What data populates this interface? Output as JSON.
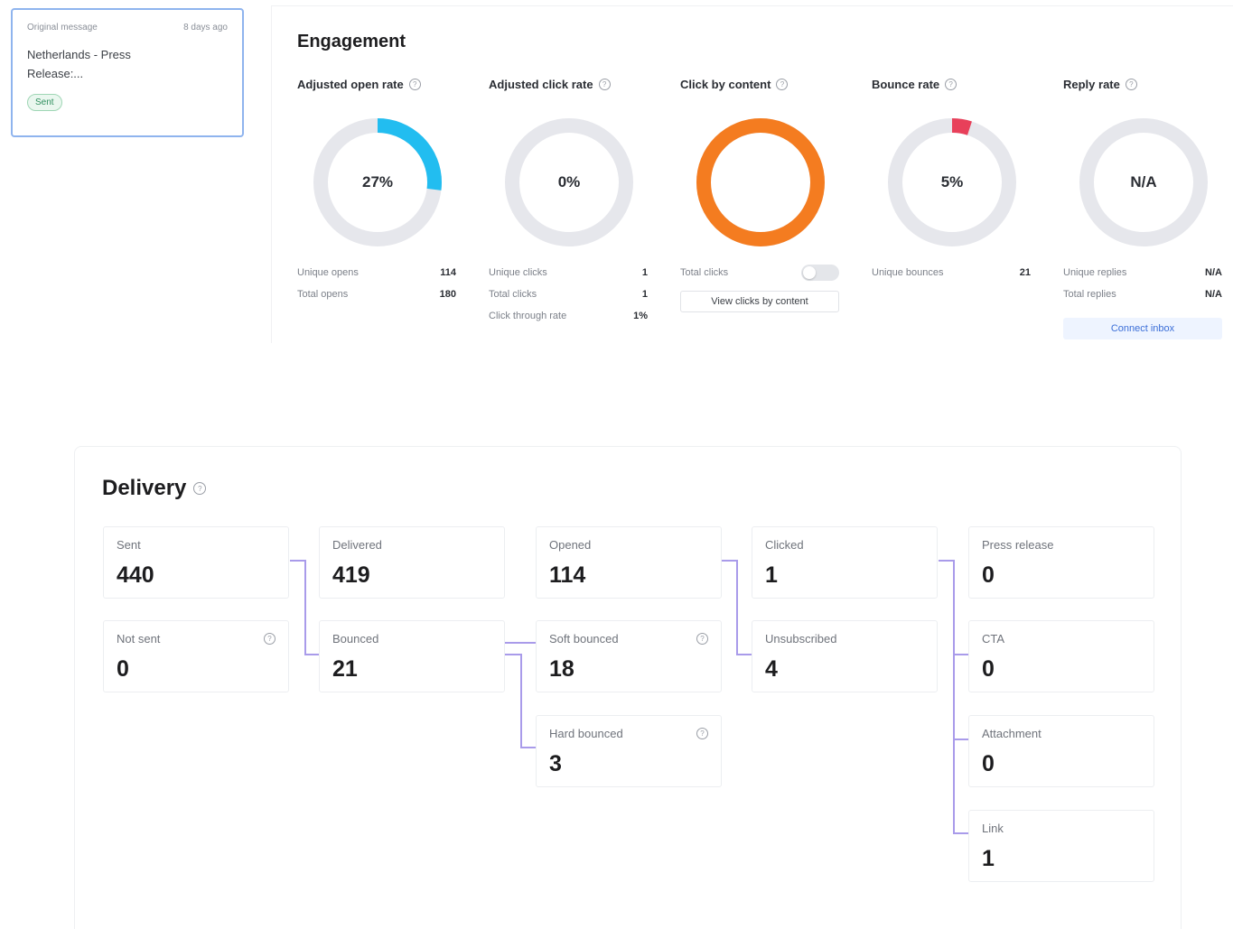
{
  "message_card": {
    "label": "Original message",
    "time": "8 days ago",
    "title": "Netherlands - Press Release:...",
    "status": "Sent"
  },
  "engagement": {
    "title": "Engagement",
    "columns": [
      {
        "title": "Adjusted open rate",
        "center": "27%",
        "percent": 27,
        "color": "#22bdf0",
        "stats": [
          {
            "label": "Unique opens",
            "value": "114"
          },
          {
            "label": "Total opens",
            "value": "180"
          }
        ]
      },
      {
        "title": "Adjusted click rate",
        "center": "0%",
        "percent": 0,
        "color": "#22bdf0",
        "stats": [
          {
            "label": "Unique clicks",
            "value": "1"
          },
          {
            "label": "Total clicks",
            "value": "1"
          },
          {
            "label": "Click through rate",
            "value": "1%"
          }
        ]
      },
      {
        "title": "Click by content",
        "center": "",
        "percent": 100,
        "color": "#f47c20",
        "toggle_label": "Total clicks",
        "button_label": "View clicks by content"
      },
      {
        "title": "Bounce rate",
        "center": "5%",
        "percent": 5,
        "color": "#e8405a",
        "stats": [
          {
            "label": "Unique bounces",
            "value": "21"
          }
        ]
      },
      {
        "title": "Reply rate",
        "center": "N/A",
        "percent": 0,
        "color": "#22bdf0",
        "stats": [
          {
            "label": "Unique replies",
            "value": "N/A"
          },
          {
            "label": "Total replies",
            "value": "N/A"
          }
        ],
        "link_label": "Connect inbox"
      }
    ]
  },
  "delivery": {
    "title": "Delivery",
    "boxes": {
      "sent": {
        "label": "Sent",
        "value": "440"
      },
      "not_sent": {
        "label": "Not sent",
        "value": "0"
      },
      "delivered": {
        "label": "Delivered",
        "value": "419"
      },
      "bounced": {
        "label": "Bounced",
        "value": "21"
      },
      "opened": {
        "label": "Opened",
        "value": "114"
      },
      "soft_bounced": {
        "label": "Soft bounced",
        "value": "18"
      },
      "hard_bounced": {
        "label": "Hard bounced",
        "value": "3"
      },
      "clicked": {
        "label": "Clicked",
        "value": "1"
      },
      "unsubscribed": {
        "label": "Unsubscribed",
        "value": "4"
      },
      "press_release": {
        "label": "Press release",
        "value": "0"
      },
      "cta": {
        "label": "CTA",
        "value": "0"
      },
      "attachment": {
        "label": "Attachment",
        "value": "0"
      },
      "link": {
        "label": "Link",
        "value": "1"
      }
    }
  }
}
